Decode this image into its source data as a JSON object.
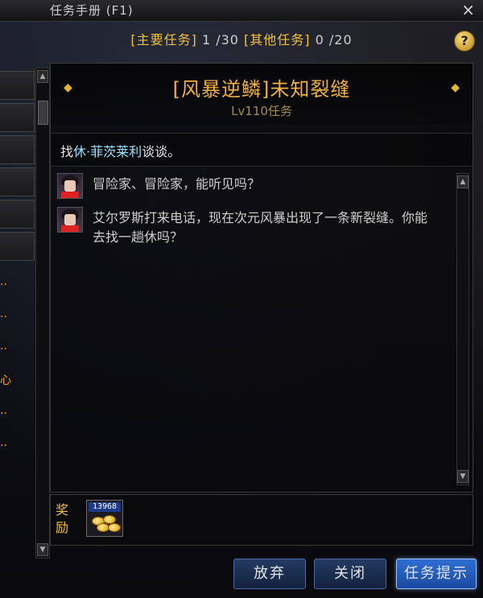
{
  "window": {
    "title": "任务手册 (F1)",
    "close": "×"
  },
  "counts": {
    "main_label": "[主要任务]",
    "main_value": "1 /30",
    "other_label": "[其他任务]",
    "other_value": "0 /20",
    "help": "?"
  },
  "quest_list": {
    "fragments": [
      "..",
      "..",
      "..",
      "心",
      "..",
      ".."
    ]
  },
  "quest": {
    "title": "[风暴逆鳞]未知裂缝",
    "level": "Lv110任务",
    "objective_prefix": "找",
    "objective_npc": "休·菲茨莱利",
    "objective_suffix": "谈谈。"
  },
  "dialog": [
    {
      "speaker_icon": "npc-portrait-icon",
      "text": "冒险家、冒险家，能听见吗？"
    },
    {
      "speaker_icon": "npc-portrait-icon",
      "text": "艾尔罗斯打来电话，现在次元风暴出现了一条新裂缝。你能去找一趟休吗？"
    }
  ],
  "reward": {
    "label": "奖励",
    "item_qty": "13968",
    "item_icon": "gold-coins-icon"
  },
  "buttons": {
    "abandon": "放弃",
    "close": "关闭",
    "hint": "任务提示"
  },
  "colors": {
    "accent_gold": "#f0b040",
    "npc_cyan": "#9ce2ff",
    "button_blue": "#243a62"
  }
}
